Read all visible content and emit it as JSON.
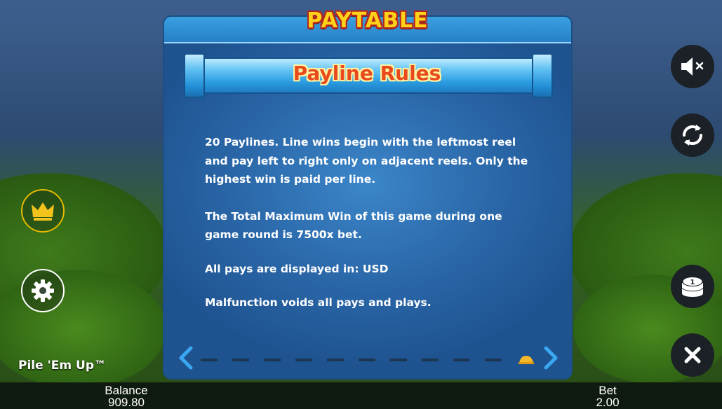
{
  "header": {
    "title": "PAYTABLE"
  },
  "section": {
    "title": "Payline Rules"
  },
  "rules": [
    "20 Paylines. Line wins begin with the leftmost reel and pay left to right only on adjacent reels. Only the highest win is paid per line.",
    "The Total Maximum Win of this game during one game round is 7500x bet.",
    "All pays are displayed in: USD",
    "Malfunction voids all pays and plays."
  ],
  "game": {
    "name": "Pile 'Em Up™"
  },
  "bottom_bar": {
    "balance_label": "Balance",
    "balance_value": "909.80",
    "bet_label": "Bet",
    "bet_value": "2.00"
  },
  "pager": {
    "total_pages": 11,
    "current_page": 11
  },
  "icons": {
    "left": [
      "crown-icon",
      "gear-icon"
    ],
    "right": [
      "sound-muted-icon",
      "autoplay-icon",
      "coin-stack-icon",
      "close-icon"
    ],
    "nav": [
      "chevron-left-icon",
      "chevron-right-icon"
    ]
  },
  "colors": {
    "title_yellow": "#ffd21a",
    "section_title_red": "#e84a1e",
    "panel_blue": "#27609e",
    "crown_gold": "#f2c31a"
  }
}
